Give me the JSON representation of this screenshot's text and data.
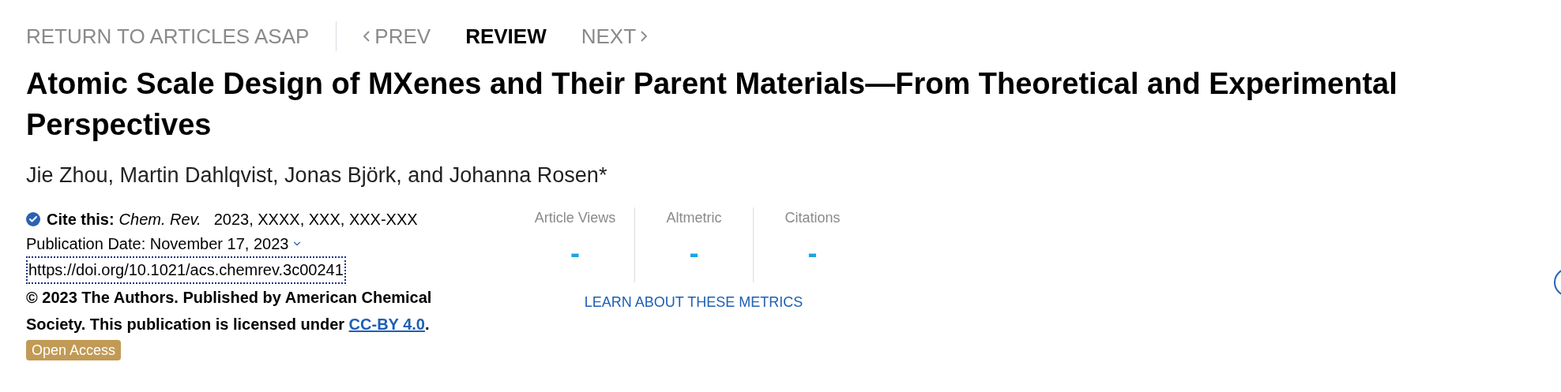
{
  "nav": {
    "return_link": "RETURN TO ARTICLES ASAP",
    "prev": "PREV",
    "section": "REVIEW",
    "next": "NEXT"
  },
  "title": "Atomic Scale Design of MXenes and Their Parent Materials—From Theoretical and Experimental Perspectives",
  "authors": "Jie Zhou, Martin Dahlqvist, Jonas Björk, and Johanna Rosen*",
  "citation": {
    "cite_label": "Cite this:",
    "journal": "Chem. Rev.",
    "details": "2023, XXXX, XXX, XXX-XXX",
    "publication_date": "Publication Date: November 17, 2023",
    "doi": "https://doi.org/10.1021/acs.chemrev.3c00241",
    "copyright": "© 2023 The Authors. Published by American Chemical Society. This publication is licensed under",
    "license_link": "CC-BY 4.0",
    "copyright_end": ".",
    "badge": "Open Access"
  },
  "metrics": [
    {
      "label": "Article Views",
      "value": "-"
    },
    {
      "label": "Altmetric",
      "value": "-"
    },
    {
      "label": "Citations",
      "value": "-"
    }
  ],
  "metrics_link": "LEARN ABOUT THESE METRICS"
}
